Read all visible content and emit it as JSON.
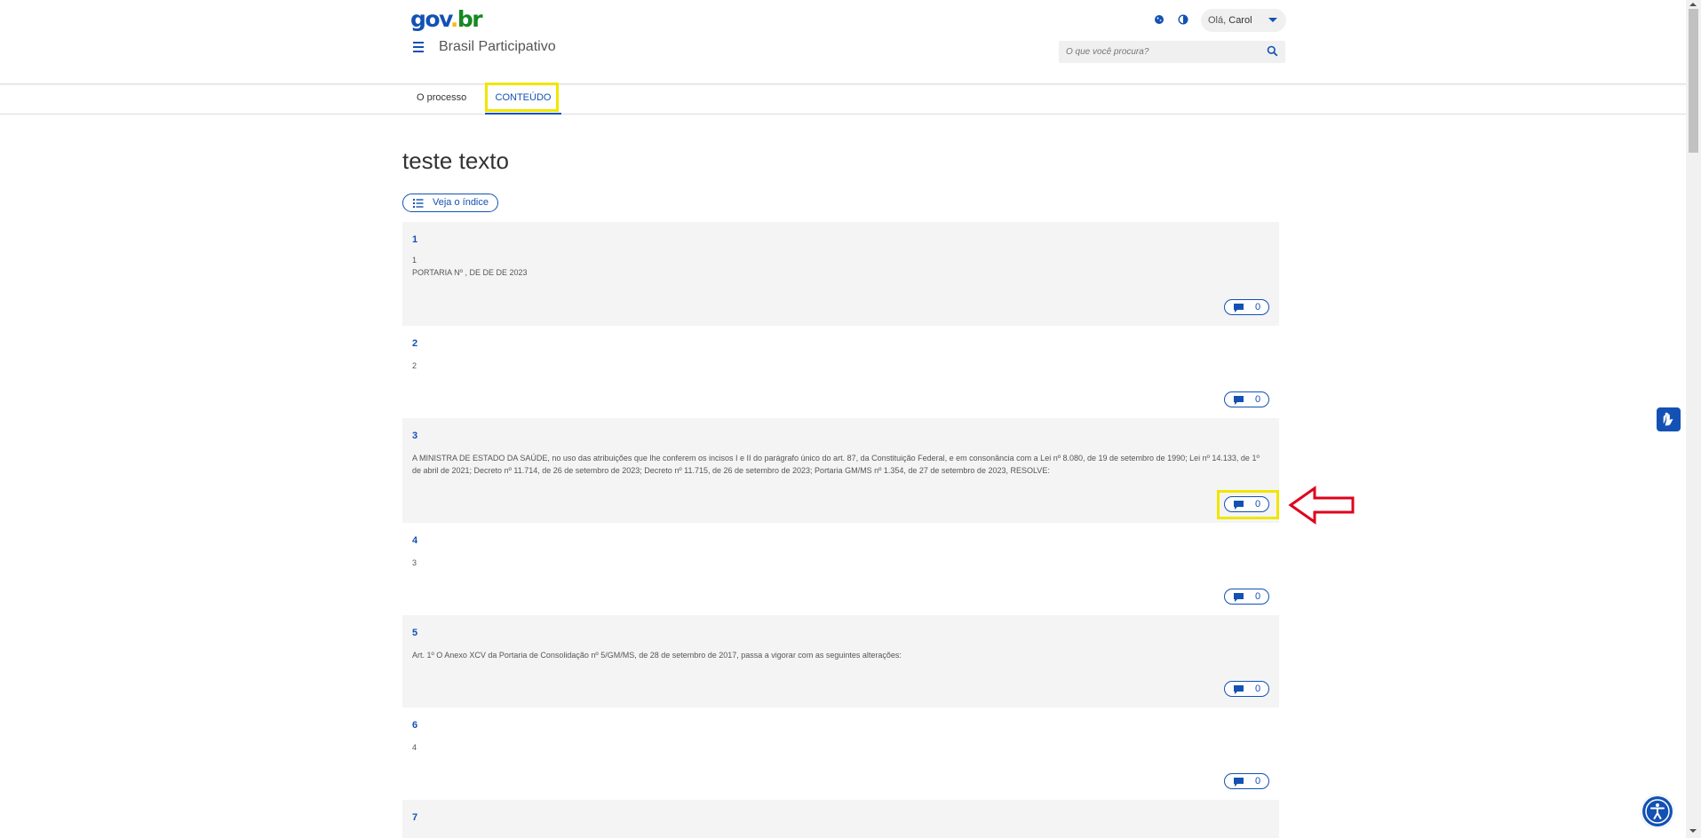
{
  "header": {
    "logo": {
      "part1": "gov",
      "part2": ".",
      "part3": "br"
    },
    "site_title": "Brasil Participativo",
    "greeting": "Olá,",
    "user_name": "Carol",
    "search_placeholder": "O que você procura?"
  },
  "tabs": [
    {
      "label": "O processo"
    },
    {
      "label": "CONTEÚDO"
    }
  ],
  "main": {
    "title": "teste texto",
    "index_button": "Veja o índice",
    "items": [
      {
        "number": "1",
        "text": "1\nPORTARIA Nº , DE DE DE 2023",
        "comments": "0"
      },
      {
        "number": "2",
        "text": "2",
        "comments": "0"
      },
      {
        "number": "3",
        "text": "A MINISTRA DE ESTADO DA SAÚDE, no uso das atribuições que lhe conferem os incisos I e II do parágrafo único do art. 87, da Constituição Federal, e em consonância com a Lei nº 8.080, de 19 de setembro de 1990; Lei nº 14.133, de 1º de abril de 2021; Decreto nº 11.714, de 26 de setembro de 2023; Decreto nº 11.715, de 26 de setembro de 2023; Portaria GM/MS nº 1.354, de 27 de setembro de 2023, RESOLVE:",
        "comments": "0"
      },
      {
        "number": "4",
        "text": "3",
        "comments": "0"
      },
      {
        "number": "5",
        "text": "Art. 1º O Anexo XCV da Portaria de Consolidação nº 5/GM/MS, de 28 de setembro de 2017, passa a vigorar com as seguintes alterações:",
        "comments": "0"
      },
      {
        "number": "6",
        "text": "4",
        "comments": "0"
      },
      {
        "number": "7",
        "text": "",
        "comments": ""
      }
    ]
  },
  "colors": {
    "primary": "#1351b4",
    "highlight": "#f0e600",
    "annotation_arrow": "#e0001a",
    "row_gray": "#f4f4f4"
  },
  "icons": [
    "menu-icon",
    "cookie-icon",
    "contrast-icon",
    "chevron-down-icon",
    "search-icon",
    "list-icon",
    "comment-icon",
    "hand-sign-icon",
    "accessibility-icon"
  ]
}
